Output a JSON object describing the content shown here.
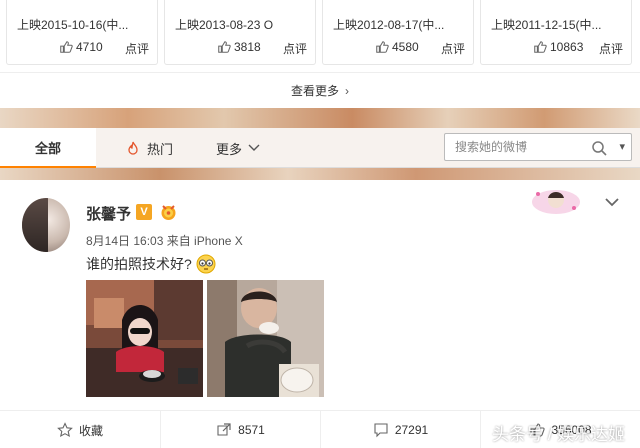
{
  "movies": [
    {
      "title_cut": "",
      "date": "上映2015-10-16(中...",
      "likes": "4710",
      "comment_label": "点评"
    },
    {
      "title_cut": "",
      "date": "上映2013-08-23 O",
      "likes": "3818",
      "comment_label": "点评"
    },
    {
      "title_cut": "",
      "date": "上映2012-08-17(中...",
      "likes": "4580",
      "comment_label": "点评"
    },
    {
      "title_cut": "",
      "date": "上映2011-12-15(中...",
      "likes": "10863",
      "comment_label": "点评"
    }
  ],
  "more": {
    "label": "查看更多"
  },
  "tabs": {
    "all": "全部",
    "hot": "热门",
    "more": "更多"
  },
  "search": {
    "placeholder": "搜索她的微博"
  },
  "post": {
    "author": "张馨予",
    "verified_badge": "V",
    "meta": "8月14日 16:03 来自 iPhone X",
    "text": "谁的拍照技术好?",
    "actions": {
      "favorite": "收藏",
      "repost": "8571",
      "comment": "27291",
      "like": "356008"
    }
  },
  "watermark": "头条号 / 娱乐达姬",
  "icons": [
    "thumb-up-icon",
    "chevron-right-icon",
    "fire-icon",
    "chevron-down-icon",
    "search-icon",
    "star-icon",
    "repost-icon",
    "comment-icon",
    "like-icon",
    "emoji-icon",
    "medal-icon"
  ],
  "colors": {
    "accent": "#ff8200",
    "verified": "#f5a623"
  }
}
